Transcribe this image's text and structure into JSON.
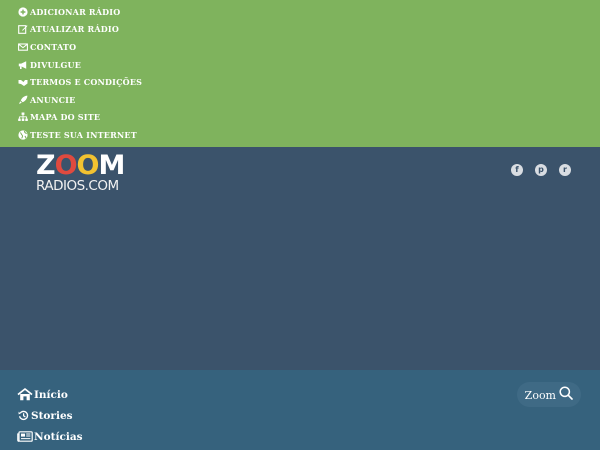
{
  "top_menu": {
    "items": [
      {
        "label": "ADICIONAR RÁDIO",
        "icon": "plus-circle-icon"
      },
      {
        "label": "ATUALIZAR RÁDIO",
        "icon": "edit-icon"
      },
      {
        "label": "CONTATO",
        "icon": "envelope-icon"
      },
      {
        "label": "DIVULGUE",
        "icon": "megaphone-icon"
      },
      {
        "label": "TERMOS E CONDIÇÕES",
        "icon": "handshake-icon"
      },
      {
        "label": "ANUNCIE",
        "icon": "rocket-icon"
      },
      {
        "label": "MAPA DO SITE",
        "icon": "sitemap-icon"
      },
      {
        "label": "TESTE SUA INTERNET",
        "icon": "globe-icon"
      }
    ]
  },
  "logo": {
    "line1": "ZOOM",
    "line2": "RADIOS.COM",
    "letter_colors": [
      "#ffffff",
      "#e04a3f",
      "#f2c230",
      "#ffffff"
    ]
  },
  "social": [
    {
      "name": "facebook",
      "glyph": "f"
    },
    {
      "name": "pinterest",
      "glyph": "p"
    },
    {
      "name": "reddit",
      "glyph": "r"
    }
  ],
  "main_nav": {
    "items": [
      {
        "label": "Início",
        "icon": "home-icon"
      },
      {
        "label": "Stories",
        "icon": "history-icon"
      },
      {
        "label": "Notícias",
        "icon": "newspaper-icon"
      }
    ]
  },
  "search": {
    "label": "Zoom",
    "icon": "search-icon"
  },
  "colors": {
    "top_bar": "#7fb35d",
    "header": "#3b536b",
    "nav_bar": "#36627d",
    "text": "#ffffff"
  }
}
